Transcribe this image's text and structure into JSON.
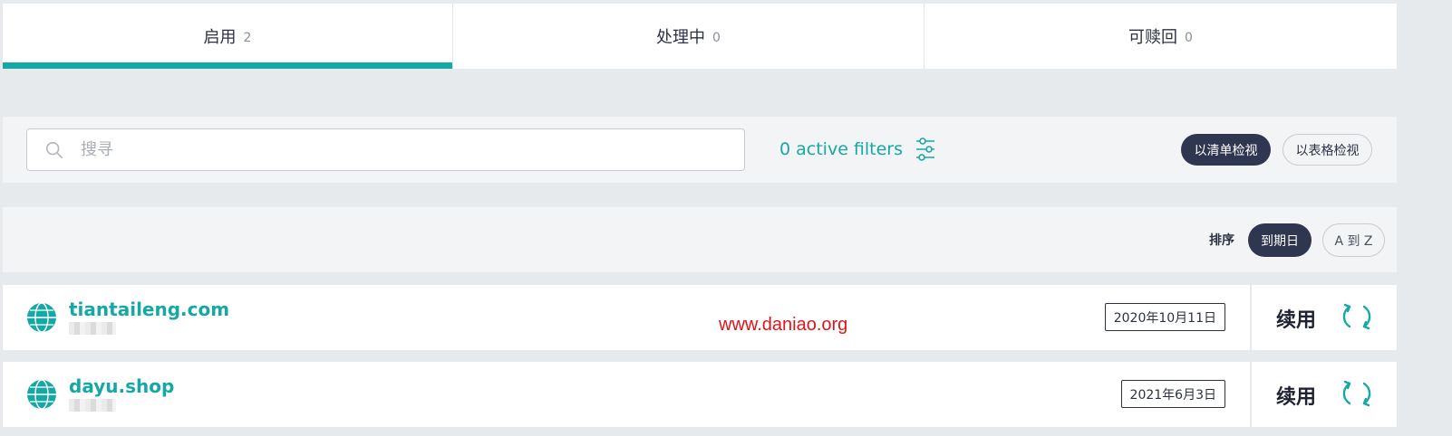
{
  "tabs": [
    {
      "label": "启用",
      "count": "2",
      "active": true
    },
    {
      "label": "处理中",
      "count": "0",
      "active": false
    },
    {
      "label": "可赎回",
      "count": "0",
      "active": false
    }
  ],
  "search": {
    "placeholder": "搜寻",
    "value": "",
    "icon": "search-icon"
  },
  "filters": {
    "label": "0 active filters",
    "icon": "sliders-icon"
  },
  "view_toggle": {
    "list_label": "以清单检视",
    "table_label": "以表格检视",
    "selected": "list"
  },
  "sort": {
    "label": "排序",
    "options": [
      "到期日",
      "A 到 Z"
    ],
    "selected": "到期日"
  },
  "domains": [
    {
      "name": "tiantaileng.com",
      "expiry": "2020年10月11日",
      "renew_label": "续用"
    },
    {
      "name": "dayu.shop",
      "expiry": "2021年6月3日",
      "renew_label": "续用"
    }
  ],
  "watermark": "www.daniao.org",
  "colors": {
    "accent": "#16a8a4",
    "dark_button": "#2f3650",
    "page_bg": "#e7eaed",
    "watermark": "#e0141a"
  }
}
